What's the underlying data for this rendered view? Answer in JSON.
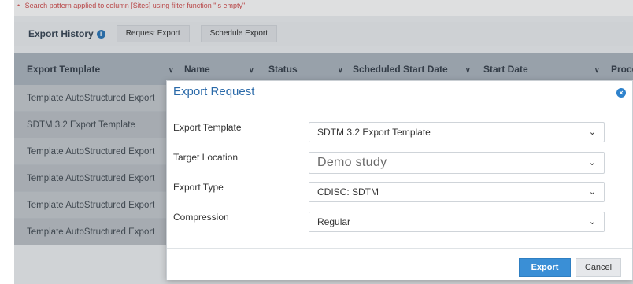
{
  "notice": {
    "bullet": "•",
    "text": "Search pattern applied to column [Sites] using filter function \"is empty\""
  },
  "history": {
    "title": "Export History",
    "info_icon": "i",
    "request_export": "Request Export",
    "schedule_export": "Schedule Export"
  },
  "grid": {
    "columns": [
      "Export Template",
      "Name",
      "Status",
      "Scheduled Start Date",
      "Start Date",
      "Proce"
    ],
    "chevron": "∨",
    "rows": [
      "Template AutoStructured Export",
      "SDTM 3.2 Export Template",
      "Template AutoStructured Export",
      "Template AutoStructured Export",
      "Template AutoStructured Export",
      "Template AutoStructured Export"
    ]
  },
  "modal": {
    "title": "Export Request",
    "close_icon": "×",
    "fields": [
      {
        "label": "Export Template",
        "value": "SDTM 3.2 Export Template"
      },
      {
        "label": "Target Location",
        "value": "Demo study"
      },
      {
        "label": "Export Type",
        "value": "CDISC: SDTM"
      },
      {
        "label": "Compression",
        "value": "Regular"
      }
    ],
    "caret": "⌄",
    "export_label": "Export",
    "cancel_label": "Cancel"
  },
  "colors": {
    "accent": "#2e82cc",
    "header_bg": "#a8b2bc",
    "modal_title": "#2b6aa9"
  }
}
